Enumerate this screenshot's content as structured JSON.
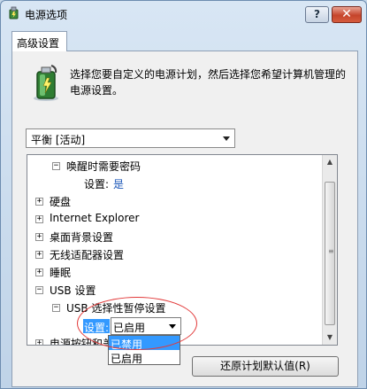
{
  "window": {
    "title": "电源选项",
    "help_label": "?",
    "close_label": "✕"
  },
  "tab": {
    "label": "高级设置"
  },
  "intro": {
    "text": "选择您要自定义的电源计划，然后选择您希望计算机管理的电源设置。"
  },
  "plan_combo": {
    "value": "平衡 [活动]"
  },
  "tree": {
    "rows": [
      {
        "label": "唤醒时需要密码",
        "expander": "⊟"
      },
      {
        "label": "设置:",
        "value": "是"
      },
      {
        "label": "硬盘",
        "expander": "⊞"
      },
      {
        "label": "Internet Explorer",
        "expander": "⊞"
      },
      {
        "label": "桌面背景设置",
        "expander": "⊞"
      },
      {
        "label": "无线适配器设置",
        "expander": "⊞"
      },
      {
        "label": "睡眠",
        "expander": "⊞"
      },
      {
        "label": "USB 设置",
        "expander": "⊟"
      },
      {
        "label": "USB 选择性暂停设置",
        "expander": "⊟"
      },
      {
        "label": "设置:"
      },
      {
        "label": "电源按钮和盖子",
        "expander": "⊞"
      }
    ],
    "scroll_up": "▲",
    "scroll_down": "▼",
    "grip": "≡"
  },
  "usb_suspend_dropdown": {
    "selected": "已启用",
    "options": [
      "已禁用",
      "已启用"
    ],
    "highlighted_option": "已禁用"
  },
  "restore_button": {
    "label": "还原计划默认值(R)"
  },
  "colors": {
    "selection": "#3399ff",
    "link": "#1c57b8",
    "annotation": "#e23a3a"
  }
}
